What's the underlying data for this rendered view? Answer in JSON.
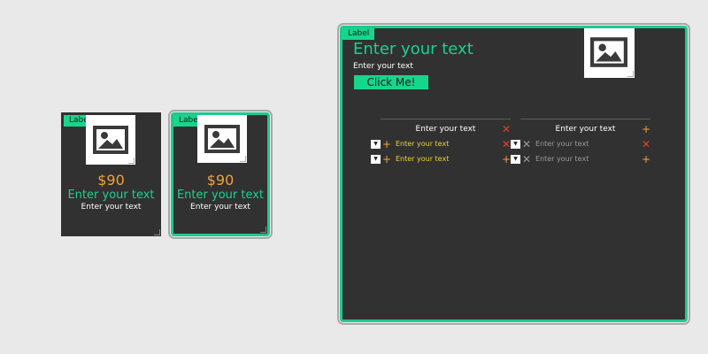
{
  "card1": {
    "label": "Label",
    "price": "$90",
    "title": "Enter your text",
    "subtitle": "Enter your text",
    "image_icon": "image-icon"
  },
  "card2": {
    "label": "Label",
    "price": "$90",
    "title": "Enter your text",
    "subtitle": "Enter your text",
    "image_icon": "image-icon"
  },
  "panel": {
    "label": "Label",
    "title": "Enter your text",
    "subtitle": "Enter your text",
    "button_label": "Click Me!",
    "image_icon": "image-icon",
    "left_list": {
      "header": "Enter your text",
      "header_icon": "close-icon",
      "rows": [
        {
          "text": "Enter your text",
          "trailing_icon": "close-icon"
        },
        {
          "text": "Enter your text",
          "trailing_icon": "plus-icon"
        }
      ]
    },
    "right_list": {
      "header": "Enter your text",
      "header_icon": "plus-icon",
      "rows": [
        {
          "text": "Enter your text",
          "trailing_icon": "close-icon"
        },
        {
          "text": "Enter your text",
          "trailing_icon": "plus-icon"
        }
      ]
    }
  },
  "colors": {
    "background": "#e9e9e9",
    "card_bg": "#313131",
    "accent_green": "#16d68c",
    "price_orange": "#f0a23a",
    "row_yellow": "#e8d538",
    "close_red": "#e2402f"
  }
}
